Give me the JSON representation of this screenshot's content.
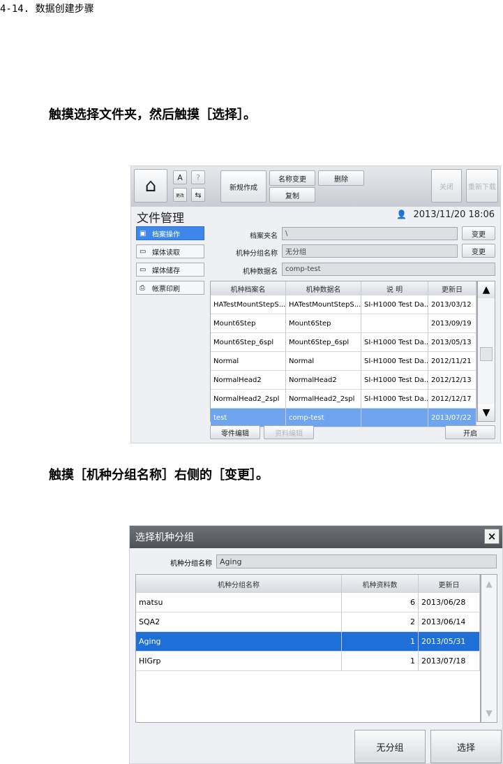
{
  "caption": "4-14. 数据创建步骤",
  "instruction1": "触摸选择文件夹，然后触摸［选择］。",
  "instruction2": "触摸［机种分组名称］右侧的［变更］。",
  "screen1": {
    "toolbar": {
      "mini_icon_a": "A",
      "mini_icon_help": "?",
      "mini_label_1": "更改",
      "new_label": "新规作成",
      "rename_label": "名称变更",
      "delete_label": "删除",
      "copy_label": "复制",
      "close_label": "关闭",
      "reload_label": "重新下载"
    },
    "title": "文件管理",
    "datetime": "2013/11/20 18:06",
    "sidebar": [
      {
        "label": "档案操作",
        "icon": "folder-icon",
        "selected": true
      },
      {
        "label": "媒体读取",
        "icon": "media-read-icon",
        "selected": false
      },
      {
        "label": "媒体储存",
        "icon": "media-save-icon",
        "selected": false
      },
      {
        "label": "帐票印刷",
        "icon": "printer-icon",
        "selected": false
      }
    ],
    "fields": {
      "folder_label": "档案夹名",
      "folder_value": "\\",
      "group_label": "机种分组名称",
      "group_value": "无分组",
      "data_label": "机种数据名",
      "data_value": "comp-test",
      "change_label": "变更"
    },
    "table": {
      "headers": [
        "机种档案名",
        "机种数据名",
        "说 明",
        "更新日"
      ],
      "rows": [
        [
          "HATestMountStepS...",
          "HATestMountStepS...",
          "SI-H1000 Test Da...",
          "2013/03/12"
        ],
        [
          "Mount6Step",
          "Mount6Step",
          "",
          "2013/09/19"
        ],
        [
          "Mount6Step_6spl",
          "Mount6Step_6spl",
          "SI-H1000 Test Da...",
          "2013/05/13"
        ],
        [
          "Normal",
          "Normal",
          "SI-H1000 Test Da...",
          "2012/11/21"
        ],
        [
          "NormalHead2",
          "NormalHead2",
          "SI-H1000 Test Da...",
          "2012/12/13"
        ],
        [
          "NormalHead2_2spl",
          "NormalHead2_2spl",
          "SI-H1000 Test Da...",
          "2012/12/17"
        ],
        [
          "test",
          "comp-test",
          "",
          "2013/07/22"
        ]
      ],
      "selected_row": 6
    },
    "bottom": {
      "parts_edit": "零件编辑",
      "data_edit": "资料编辑",
      "open": "开启"
    }
  },
  "screen2": {
    "title": "选择机种分组",
    "close_glyph": "×",
    "group_label": "机种分组名称",
    "group_value": "Aging",
    "table": {
      "headers": [
        "机种分组名称",
        "机种资料数",
        "更新日"
      ],
      "rows": [
        [
          "matsu",
          "6",
          "2013/06/28"
        ],
        [
          "SQA2",
          "2",
          "2013/06/14"
        ],
        [
          "Aging",
          "1",
          "2013/05/31"
        ],
        [
          "HIGrp",
          "1",
          "2013/07/18"
        ]
      ],
      "selected_row": 2
    },
    "no_group_label": "无分组",
    "select_label": "选择"
  }
}
